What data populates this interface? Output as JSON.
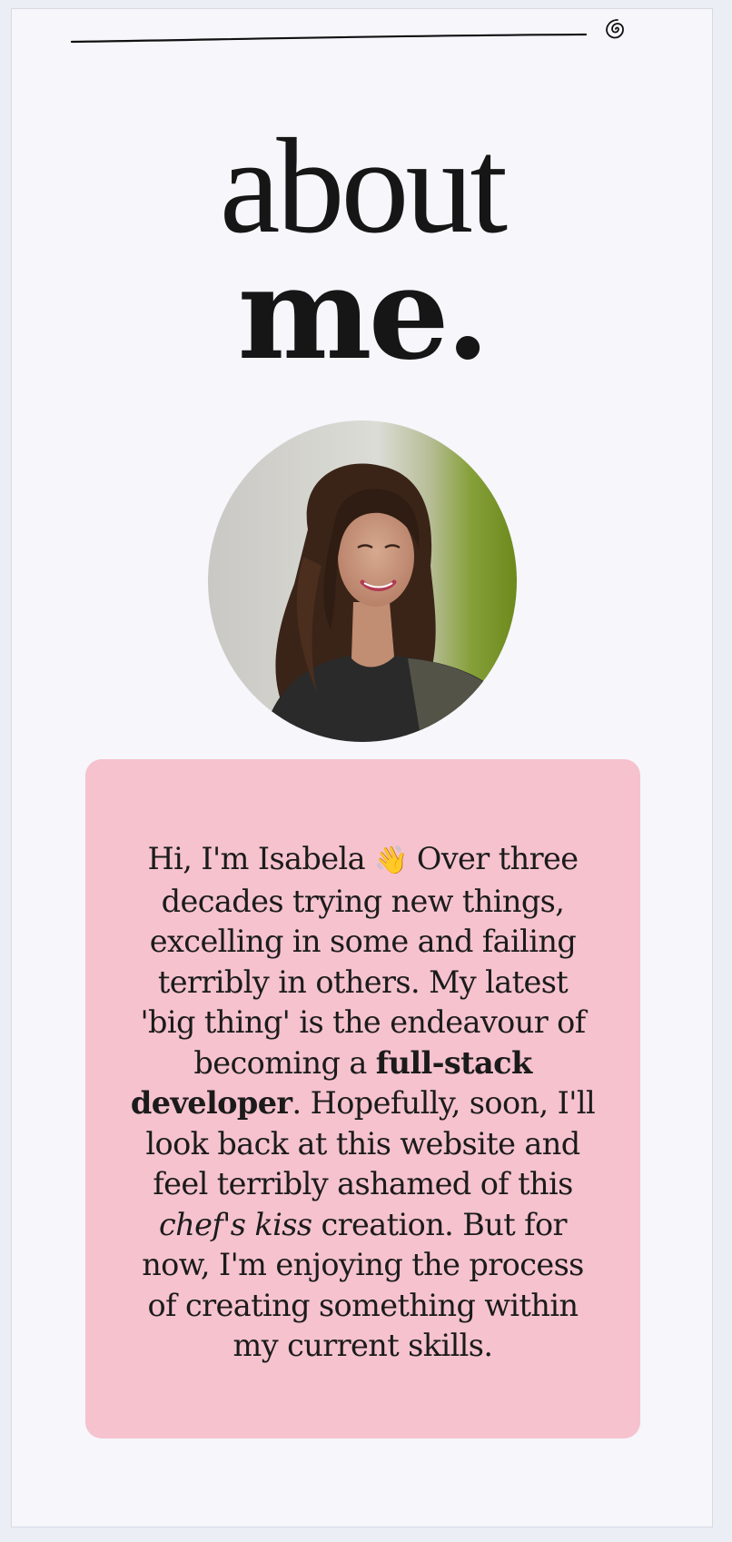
{
  "header": {
    "menu_icon": "spiral-icon"
  },
  "title": {
    "line1": "about",
    "line2": "me."
  },
  "portrait": {
    "icon": "portrait-photo"
  },
  "bio": {
    "intro": "Hi, I'm Isabela ",
    "wave_icon": "👋",
    "part1": " Over three decades trying new things, excelling in some and failing terribly in others. My latest 'big thing' is the endeavour of becoming a ",
    "bold": "full-stack developer",
    "part2": ". Hopefully, soon, I'll look back at this website and feel terribly ashamed of this ",
    "italic": "chef's kiss",
    "part3": " creation. But for now, I'm enjoying the process of creating something within my current skills."
  },
  "colors": {
    "page_background": "#f6f6fb",
    "card_background": "#f5c2ce",
    "text": "#161616"
  }
}
